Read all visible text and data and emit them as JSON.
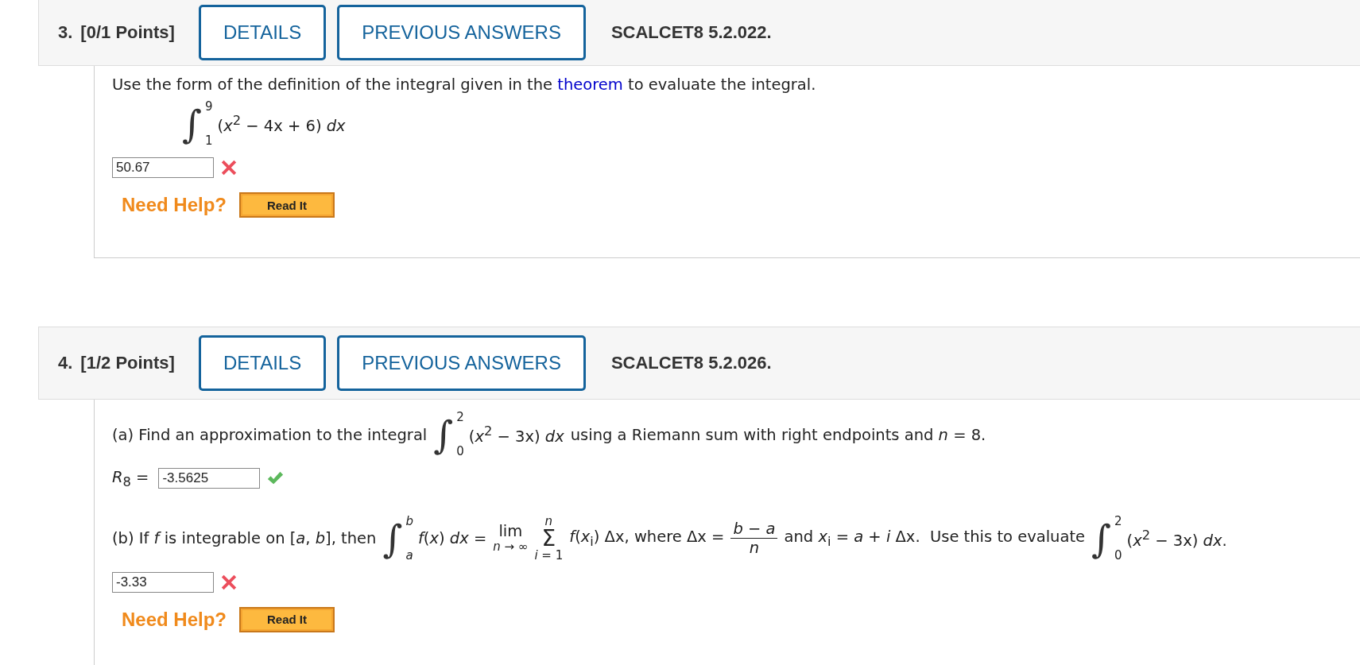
{
  "questions": [
    {
      "number": "3.",
      "points": "[0/1 Points]",
      "buttons": [
        "DETAILS",
        "PREVIOUS ANSWERS"
      ],
      "code": "SCALCET8 5.2.022.",
      "body": [
        {
          "kind": "line",
          "segments": [
            {
              "kind": "text",
              "text": "Use the form of the definition of the integral given in the ",
              "link": "theorem",
              "after": " to evaluate the integral."
            }
          ]
        },
        {
          "kind": "display",
          "segments": [
            {
              "kind": "integral",
              "sign": "∫",
              "upper": "9",
              "lower": "1",
              "integrand": "(*x*$^{2}$ − 4x + 6) *dx*"
            }
          ]
        },
        {
          "kind": "answer",
          "value": "50.67",
          "correct": false
        },
        {
          "kind": "help",
          "label": "Need Help?",
          "button": "Read It"
        }
      ]
    },
    {
      "number": "4.",
      "points": "[1/2 Points]",
      "buttons": [
        "DETAILS",
        "PREVIOUS ANSWERS"
      ],
      "code": "SCALCET8 5.2.026.",
      "body": [
        {
          "kind": "line",
          "segments": [
            {
              "kind": "text",
              "text": "(a) Find an approximation to the integral"
            },
            {
              "kind": "integral",
              "sign": "∫",
              "upper": "2",
              "lower": "0",
              "integrand": "(*x*$^{2}$ − 3x) *dx*"
            },
            {
              "kind": "text",
              "text": "using a Riemann sum with right endpoints and *n* = 8."
            }
          ]
        },
        {
          "kind": "answer",
          "label": "*R*$_{8}$ =",
          "value": "-3.5625",
          "correct": true
        },
        {
          "kind": "line",
          "segments": [
            {
              "kind": "text",
              "text": "(b) If *f* is integrable on [*a*, *b*], then"
            },
            {
              "kind": "integral",
              "sign": "∫",
              "upper": "*b*",
              "lower": "*a*",
              "integrand": "*f*(*x*) *dx* ="
            },
            {
              "kind": "limit",
              "label": "lim",
              "under": "*n* → ∞"
            },
            {
              "kind": "sum",
              "sign": "Σ",
              "upper": "*n*",
              "lower": "*i* = 1"
            },
            {
              "kind": "text",
              "text": "*f*(*x*$_{i}$) Δx, where Δx ="
            },
            {
              "kind": "fraction",
              "numerator": "*b* − *a*",
              "denominator": "*n*"
            },
            {
              "kind": "text",
              "text": "and *x*$_{i}$ = *a* + *i* Δx.  Use this to evaluate"
            },
            {
              "kind": "integral",
              "sign": "∫",
              "upper": "2",
              "lower": "0",
              "integrand": "(*x*$^{2}$ − 3x) *dx*."
            }
          ]
        },
        {
          "kind": "answer",
          "value": "-3.33",
          "correct": false
        },
        {
          "kind": "help",
          "label": "Need Help?",
          "button": "Read It"
        }
      ]
    }
  ]
}
